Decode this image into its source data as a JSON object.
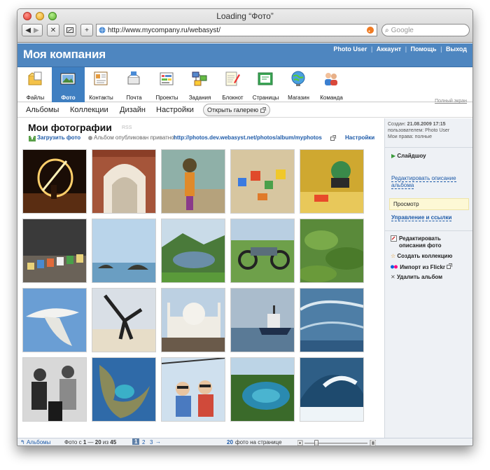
{
  "browser": {
    "title": "Loading “Фото”",
    "url": "http://www.mycompany.ru/webasyst/",
    "search_placeholder": "Google"
  },
  "header": {
    "company": "Моя компания",
    "user_link": "Photo User",
    "account_link": "Аккаунт",
    "help_link": "Помощь",
    "logout_link": "Выход"
  },
  "apps": [
    {
      "label": "Файлы",
      "icon": "files-icon"
    },
    {
      "label": "Фото",
      "icon": "photo-icon"
    },
    {
      "label": "Контакты",
      "icon": "contacts-icon"
    },
    {
      "label": "Почта",
      "icon": "mail-icon"
    },
    {
      "label": "Проекты",
      "icon": "projects-icon"
    },
    {
      "label": "Задания",
      "icon": "tasks-icon"
    },
    {
      "label": "Блокнот",
      "icon": "notepad-icon"
    },
    {
      "label": "Страницы",
      "icon": "pages-icon"
    },
    {
      "label": "Магазин",
      "icon": "shop-icon"
    },
    {
      "label": "Команда",
      "icon": "team-icon"
    }
  ],
  "subnav": {
    "albums": "Альбомы",
    "collections": "Коллекции",
    "design": "Дизайн",
    "settings": "Настройки",
    "open_gallery": "Открыть галерею",
    "fullscreen": "Полный экран"
  },
  "album": {
    "title": "Мои фотографии",
    "rss": "RSS",
    "upload": "Загрузить фото",
    "published_text": "Альбом опубликован приватно:",
    "published_url": "http://photos.dev.webasyst.net/photos/album/myphotos",
    "settings_link": "Настройки"
  },
  "meta": {
    "created_label": "Создан:",
    "created_value": "21.08.2009 17:15",
    "user_label": "пользователем:",
    "user_value": "Photo User",
    "rights_label": "Мои права:",
    "rights_value": "полные"
  },
  "sidebar": {
    "slideshow": "Слайдшоу",
    "edit_desc": "Редактировать описание альбома",
    "view": "Просмотр",
    "manage": "Управление и ссылки",
    "edit_photos": "Редактировать описания фото",
    "create_collection": "Создать коллекцию",
    "import_flickr": "Импорт из Flickr",
    "delete_album": "Удалить альбом"
  },
  "footer": {
    "albums_link": "Альбомы",
    "range_prefix": "Фото с",
    "range_from": "1",
    "range_dash": "—",
    "range_to": "20",
    "range_of": "из",
    "total": "45",
    "pages": [
      "1",
      "2",
      "3"
    ],
    "next_arrow": "→",
    "per_page": "20",
    "per_page_label": "фото на странице"
  },
  "colors": {
    "header_bg": "#4e86c0",
    "active_app": "#3f7fc1",
    "link": "#1d5aa8",
    "sidebar_bg": "#eef1f5"
  }
}
